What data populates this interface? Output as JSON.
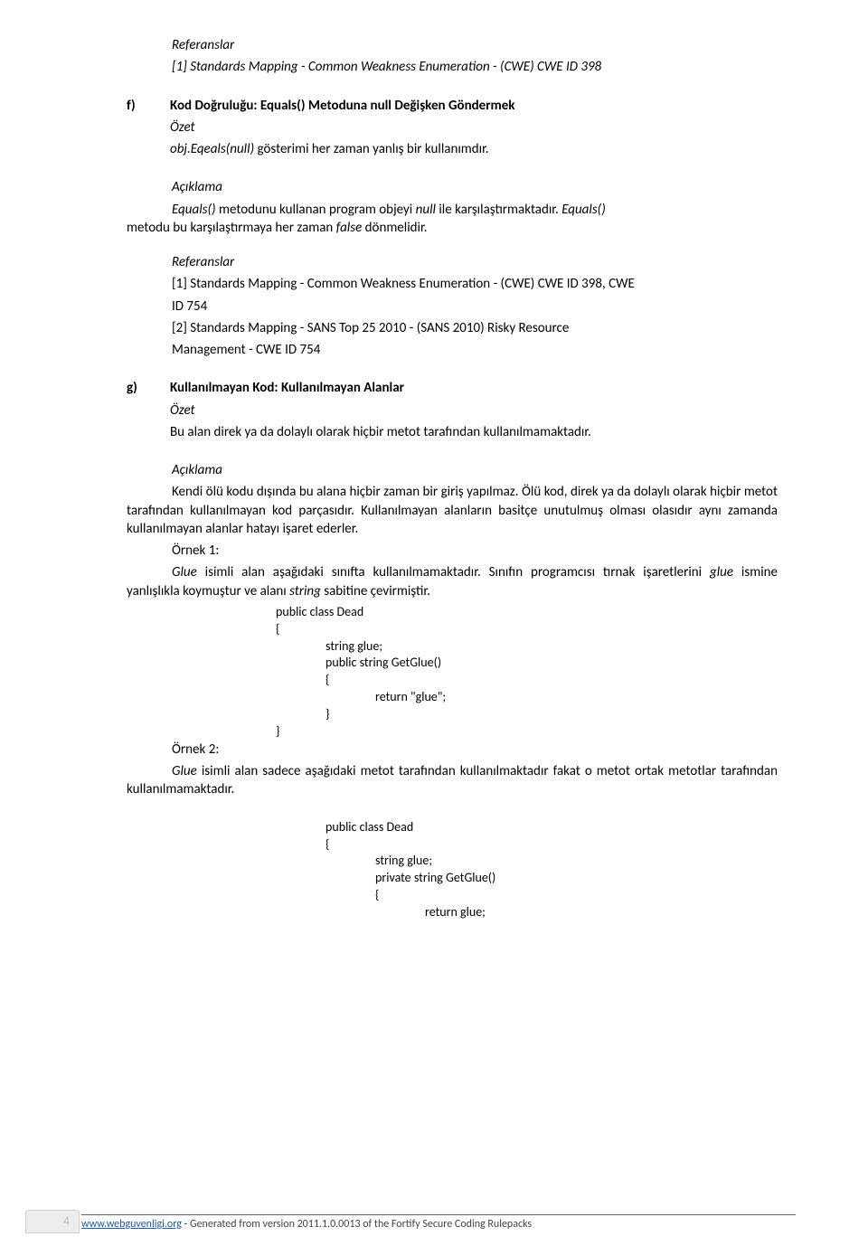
{
  "ref_header": "Referanslar",
  "top_ref": "[1] Standards Mapping - Common Weakness Enumeration - (CWE) CWE ID 398",
  "f": {
    "marker": "f)",
    "title": "Kod Doğruluğu: Equals() Metoduna null Değişken Göndermek",
    "ozet_label": "Özet",
    "ozet_text": " gösterimi her zaman yanlış bir kullanımdır.",
    "ozet_prefix": "obj.Eqeals(null)",
    "aciklama_label": "Açıklama",
    "aciklama_1a": "Equals()",
    "aciklama_1b": " metodunu kullanan program objeyi ",
    "aciklama_1c": "null",
    "aciklama_1d": " ile karşılaştırmaktadır. ",
    "aciklama_1e": "Equals()",
    "aciklama_2a": "metodu bu karşılaştırmaya her zaman ",
    "aciklama_2b": "false",
    "aciklama_2c": " dönmelidir.",
    "ref_label": "Referanslar",
    "ref1a": "[1] Standards Mapping - Common Weakness Enumeration - (CWE) CWE ID 398, CWE",
    "ref1b": "ID 754",
    "ref2a": "[2] Standards Mapping - SANS Top 25 2010 - (SANS 2010) Risky Resource",
    "ref2b": "Management - CWE ID 754"
  },
  "g": {
    "marker": "g)",
    "title": "Kullanılmayan Kod: Kullanılmayan Alanlar",
    "ozet_label": "Özet",
    "ozet_text": "Bu alan direk ya da dolaylı olarak hiçbir metot tarafından kullanılmamaktadır.",
    "aciklama_label": "Açıklama",
    "p1": "Kendi ölü kodu dışında bu alana hiçbir zaman bir giriş yapılmaz. Ölü kod, direk ya da dolaylı olarak hiçbir metot tarafından kullanılmayan kod parçasıdır. Kullanılmayan alanların basitçe unutulmuş olması olasıdır aynı zamanda kullanılmayan alanlar hatayı işaret ederler.",
    "ornek1_label": "Örnek 1:",
    "ornek1_a": "Glue",
    "ornek1_b": " isimli alan aşağıdaki sınıfta kullanılmamaktadır. Sınıfın programcısı tırnak işaretlerini ",
    "ornek1_c": "glue",
    "ornek1_d": " ismine yanlışlıkla koymuştur ve alanı ",
    "ornek1_e": "string",
    "ornek1_f": " sabitine çevirmiştir.",
    "ornek2_label": "Örnek 2:",
    "ornek2_a": "Glue",
    "ornek2_b": " isimli alan sadece aşağıdaki metot tarafından kullanılmaktadır fakat o metot ortak metotlar tarafından kullanılmamaktadır."
  },
  "code1": {
    "l1": "public class Dead",
    "l2": "{",
    "l3": "string glue;",
    "l4": "public string GetGlue()",
    "l5": "{",
    "l6": "return \"glue\";",
    "l7": "}",
    "l8": "}"
  },
  "code2": {
    "l1": "public class Dead",
    "l2": "{",
    "l3": "string glue;",
    "l4": "private string GetGlue()",
    "l5": "{",
    "l6": "return glue;"
  },
  "footer": {
    "page_num": "4",
    "link": "www.webguvenligi.org",
    "rest": " - Generated from version 2011.1.0.0013 of the Fortify Secure Coding Rulepacks"
  }
}
